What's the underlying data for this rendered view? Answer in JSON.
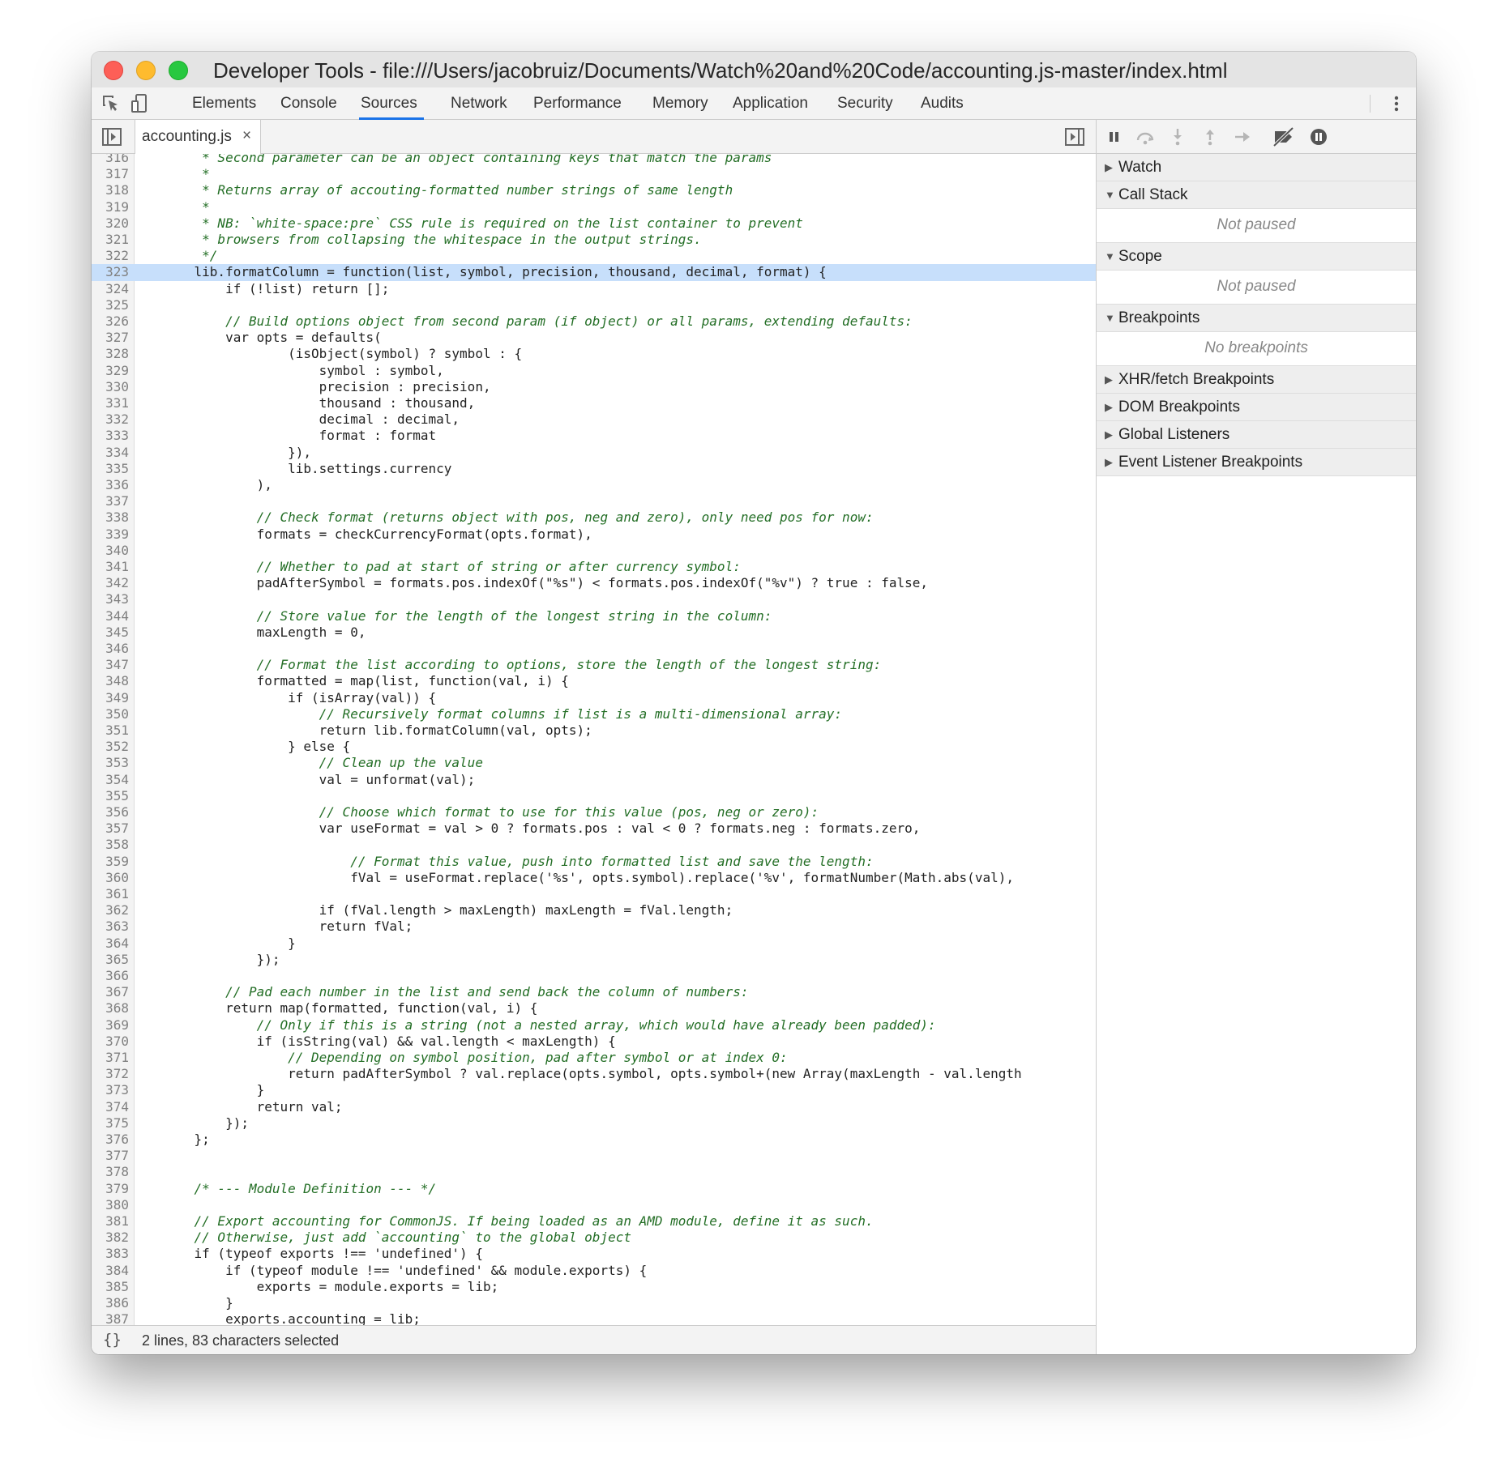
{
  "window": {
    "title": "Developer Tools - file:///Users/jacobruiz/Documents/Watch%20and%20Code/accounting.js-master/index.html"
  },
  "toolbar": {
    "inspect_icon": "element-picker-icon",
    "device_icon": "device-toolbar-icon",
    "tabs": [
      "Elements",
      "Console",
      "Sources",
      "Network",
      "Performance",
      "Memory",
      "Application",
      "Security",
      "Audits"
    ],
    "active_tab": "Sources",
    "menu_icon": "kebab-menu-icon"
  },
  "editor": {
    "file_tab": {
      "label": "accounting.js",
      "close": "×"
    },
    "navigator_toggle_icon": "navigator-toggle-icon",
    "debugger_toggle_icon": "debugger-toggle-icon",
    "highlighted_line": "323",
    "lines": [
      {
        "n": "316",
        "t": "     * Second parameter can be an object containing keys that match the params",
        "c": true
      },
      {
        "n": "317",
        "t": "     *",
        "c": true
      },
      {
        "n": "318",
        "t": "     * Returns array of accouting-formatted number strings of same length",
        "c": true
      },
      {
        "n": "319",
        "t": "     *",
        "c": true
      },
      {
        "n": "320",
        "t": "     * NB: `white-space:pre` CSS rule is required on the list container to prevent",
        "c": true
      },
      {
        "n": "321",
        "t": "     * browsers from collapsing the whitespace in the output strings.",
        "c": true
      },
      {
        "n": "322",
        "t": "     */",
        "c": true
      },
      {
        "n": "323",
        "t": "    lib.formatColumn = function(list, symbol, precision, thousand, decimal, format) {",
        "c": false
      },
      {
        "n": "324",
        "t": "        if (!list) return [];",
        "c": false
      },
      {
        "n": "325",
        "t": "",
        "c": false
      },
      {
        "n": "326",
        "t": "        // Build options object from second param (if object) or all params, extending defaults:",
        "c": true
      },
      {
        "n": "327",
        "t": "        var opts = defaults(",
        "c": false
      },
      {
        "n": "328",
        "t": "                (isObject(symbol) ? symbol : {",
        "c": false
      },
      {
        "n": "329",
        "t": "                    symbol : symbol,",
        "c": false
      },
      {
        "n": "330",
        "t": "                    precision : precision,",
        "c": false
      },
      {
        "n": "331",
        "t": "                    thousand : thousand,",
        "c": false
      },
      {
        "n": "332",
        "t": "                    decimal : decimal,",
        "c": false
      },
      {
        "n": "333",
        "t": "                    format : format",
        "c": false
      },
      {
        "n": "334",
        "t": "                }),",
        "c": false
      },
      {
        "n": "335",
        "t": "                lib.settings.currency",
        "c": false
      },
      {
        "n": "336",
        "t": "            ),",
        "c": false
      },
      {
        "n": "337",
        "t": "",
        "c": false
      },
      {
        "n": "338",
        "t": "            // Check format (returns object with pos, neg and zero), only need pos for now:",
        "c": true
      },
      {
        "n": "339",
        "t": "            formats = checkCurrencyFormat(opts.format),",
        "c": false
      },
      {
        "n": "340",
        "t": "",
        "c": false
      },
      {
        "n": "341",
        "t": "            // Whether to pad at start of string or after currency symbol:",
        "c": true
      },
      {
        "n": "342",
        "t": "            padAfterSymbol = formats.pos.indexOf(\"%s\") < formats.pos.indexOf(\"%v\") ? true : false,",
        "c": false
      },
      {
        "n": "343",
        "t": "",
        "c": false
      },
      {
        "n": "344",
        "t": "            // Store value for the length of the longest string in the column:",
        "c": true
      },
      {
        "n": "345",
        "t": "            maxLength = 0,",
        "c": false
      },
      {
        "n": "346",
        "t": "",
        "c": false
      },
      {
        "n": "347",
        "t": "            // Format the list according to options, store the length of the longest string:",
        "c": true
      },
      {
        "n": "348",
        "t": "            formatted = map(list, function(val, i) {",
        "c": false
      },
      {
        "n": "349",
        "t": "                if (isArray(val)) {",
        "c": false
      },
      {
        "n": "350",
        "t": "                    // Recursively format columns if list is a multi-dimensional array:",
        "c": true
      },
      {
        "n": "351",
        "t": "                    return lib.formatColumn(val, opts);",
        "c": false
      },
      {
        "n": "352",
        "t": "                } else {",
        "c": false
      },
      {
        "n": "353",
        "t": "                    // Clean up the value",
        "c": true
      },
      {
        "n": "354",
        "t": "                    val = unformat(val);",
        "c": false
      },
      {
        "n": "355",
        "t": "",
        "c": false
      },
      {
        "n": "356",
        "t": "                    // Choose which format to use for this value (pos, neg or zero):",
        "c": true
      },
      {
        "n": "357",
        "t": "                    var useFormat = val > 0 ? formats.pos : val < 0 ? formats.neg : formats.zero,",
        "c": false
      },
      {
        "n": "358",
        "t": "",
        "c": false
      },
      {
        "n": "359",
        "t": "                        // Format this value, push into formatted list and save the length:",
        "c": true
      },
      {
        "n": "360",
        "t": "                        fVal = useFormat.replace('%s', opts.symbol).replace('%v', formatNumber(Math.abs(val),",
        "c": false
      },
      {
        "n": "361",
        "t": "",
        "c": false
      },
      {
        "n": "362",
        "t": "                    if (fVal.length > maxLength) maxLength = fVal.length;",
        "c": false
      },
      {
        "n": "363",
        "t": "                    return fVal;",
        "c": false
      },
      {
        "n": "364",
        "t": "                }",
        "c": false
      },
      {
        "n": "365",
        "t": "            });",
        "c": false
      },
      {
        "n": "366",
        "t": "",
        "c": false
      },
      {
        "n": "367",
        "t": "        // Pad each number in the list and send back the column of numbers:",
        "c": true
      },
      {
        "n": "368",
        "t": "        return map(formatted, function(val, i) {",
        "c": false
      },
      {
        "n": "369",
        "t": "            // Only if this is a string (not a nested array, which would have already been padded):",
        "c": true
      },
      {
        "n": "370",
        "t": "            if (isString(val) && val.length < maxLength) {",
        "c": false
      },
      {
        "n": "371",
        "t": "                // Depending on symbol position, pad after symbol or at index 0:",
        "c": true
      },
      {
        "n": "372",
        "t": "                return padAfterSymbol ? val.replace(opts.symbol, opts.symbol+(new Array(maxLength - val.length",
        "c": false
      },
      {
        "n": "373",
        "t": "            }",
        "c": false
      },
      {
        "n": "374",
        "t": "            return val;",
        "c": false
      },
      {
        "n": "375",
        "t": "        });",
        "c": false
      },
      {
        "n": "376",
        "t": "    };",
        "c": false
      },
      {
        "n": "377",
        "t": "",
        "c": false
      },
      {
        "n": "378",
        "t": "",
        "c": false
      },
      {
        "n": "379",
        "t": "    /* --- Module Definition --- */",
        "c": true
      },
      {
        "n": "380",
        "t": "",
        "c": false
      },
      {
        "n": "381",
        "t": "    // Export accounting for CommonJS. If being loaded as an AMD module, define it as such.",
        "c": true
      },
      {
        "n": "382",
        "t": "    // Otherwise, just add `accounting` to the global object",
        "c": true
      },
      {
        "n": "383",
        "t": "    if (typeof exports !== 'undefined') {",
        "c": false
      },
      {
        "n": "384",
        "t": "        if (typeof module !== 'undefined' && module.exports) {",
        "c": false
      },
      {
        "n": "385",
        "t": "            exports = module.exports = lib;",
        "c": false
      },
      {
        "n": "386",
        "t": "        }",
        "c": false
      },
      {
        "n": "387",
        "t": "        exports.accounting = lib;",
        "c": false
      }
    ]
  },
  "status_bar": {
    "pretty_print_icon": "{}",
    "text": "2 lines, 83 characters selected"
  },
  "debugger": {
    "toolbar_icons": [
      "pause-icon",
      "step-over-icon",
      "step-into-icon",
      "step-out-icon",
      "step-icon",
      "deactivate-breakpoints-icon",
      "pause-on-exceptions-icon"
    ],
    "sections": [
      {
        "label": "Watch",
        "expanded": false,
        "body": ""
      },
      {
        "label": "Call Stack",
        "expanded": true,
        "body": "Not paused"
      },
      {
        "label": "Scope",
        "expanded": true,
        "body": "Not paused"
      },
      {
        "label": "Breakpoints",
        "expanded": true,
        "body": "No breakpoints"
      },
      {
        "label": "XHR/fetch Breakpoints",
        "expanded": false,
        "body": ""
      },
      {
        "label": "DOM Breakpoints",
        "expanded": false,
        "body": ""
      },
      {
        "label": "Global Listeners",
        "expanded": false,
        "body": ""
      },
      {
        "label": "Event Listener Breakpoints",
        "expanded": false,
        "body": ""
      }
    ]
  }
}
